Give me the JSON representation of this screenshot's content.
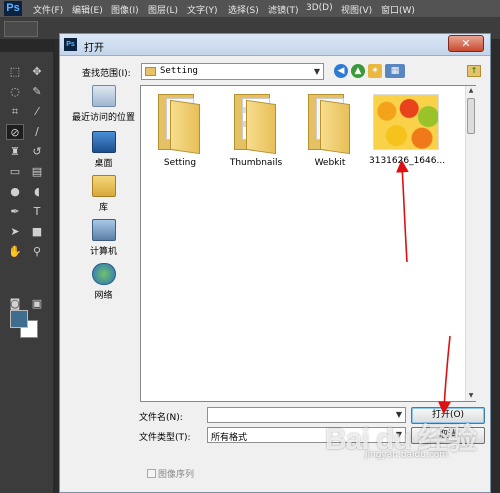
{
  "photoshop": {
    "logo": "Ps",
    "menus": [
      "文件(F)",
      "编辑(E)",
      "图像(I)",
      "图层(L)",
      "文字(Y)",
      "选择(S)",
      "滤镜(T)",
      "3D(D)",
      "视图(V)",
      "窗口(W)"
    ],
    "colors": {
      "foreground": "#3e6d8d",
      "background": "#ffffff"
    }
  },
  "dialog": {
    "title": "打开",
    "close_glyph": "✕",
    "look_in_label": "查找范围(I):",
    "look_in_value": "Setting",
    "places": [
      {
        "label": "最近访问的位置",
        "icon": "recent-places-icon"
      },
      {
        "label": "桌面",
        "icon": "desktop-icon"
      },
      {
        "label": "库",
        "icon": "libraries-icon"
      },
      {
        "label": "计算机",
        "icon": "computer-icon"
      },
      {
        "label": "网络",
        "icon": "network-icon"
      }
    ],
    "files": [
      {
        "name": "Setting",
        "type": "folder"
      },
      {
        "name": "Thumbnails",
        "type": "folder"
      },
      {
        "name": "Webkit",
        "type": "folder"
      },
      {
        "name": "3131626_1646...",
        "type": "image"
      }
    ],
    "filename_label": "文件名(N):",
    "filename_value": "",
    "filetype_label": "文件类型(T):",
    "filetype_value": "所有格式",
    "open_button": "打开(O)",
    "cancel_button": "取消",
    "image_sequence_label": "图像序列"
  },
  "watermark": {
    "main": "Bai du 经验",
    "sub": "jingyan.baidu.com"
  }
}
